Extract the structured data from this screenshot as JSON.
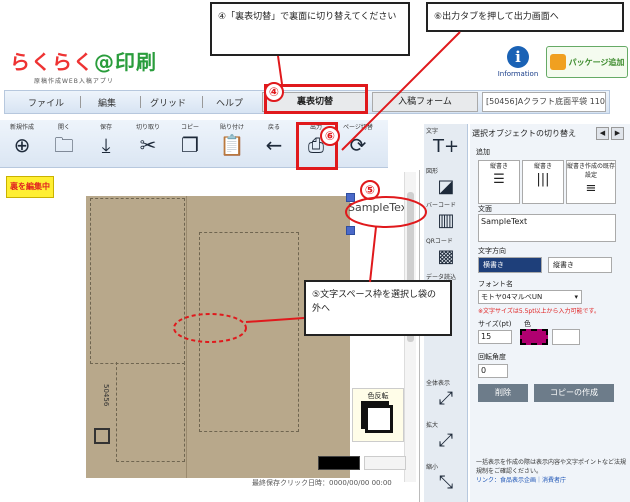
{
  "header": {
    "logo_text_red": "らくらく",
    "logo_text_green": "@印刷",
    "logo_ruby": "",
    "logo_sub": "原稿作成WEB入稿アプリ",
    "info_label": "Information",
    "package_label": "パッケージ追加"
  },
  "menu": {
    "file": "ファイル",
    "edit": "編集",
    "grid": "グリッド",
    "help": "ヘルプ",
    "flip": "裏表切替",
    "input_form": "入稿フォーム",
    "template": "[50456]Aクラフト底面平袋 110…"
  },
  "toolbar": {
    "items": [
      {
        "label": "新規作成",
        "glyph": "⊕"
      },
      {
        "label": "開く",
        "glyph": "🗀"
      },
      {
        "label": "保存",
        "glyph": "⤓"
      },
      {
        "label": "切り取り",
        "glyph": "✂"
      },
      {
        "label": "コピー",
        "glyph": "❐"
      },
      {
        "label": "貼り付け",
        "glyph": "📋"
      },
      {
        "label": "戻る",
        "glyph": "←"
      },
      {
        "label": "出力",
        "glyph": "⎙"
      },
      {
        "label": "ページ切替",
        "glyph": "⟳"
      }
    ]
  },
  "canvas": {
    "back_badge": "裏を編集中",
    "sample_text": "SampleText",
    "reverse_label": "色反転",
    "save_time": "最終保存クリック日時：0000/00/00 00:00",
    "barcode_text": "50456"
  },
  "side_tools": [
    {
      "label": "文字",
      "glyph": "T+"
    },
    {
      "label": "図形",
      "glyph": "◪"
    },
    {
      "label": "バーコード",
      "glyph": "▥"
    },
    {
      "label": "QRコード",
      "glyph": "▩"
    },
    {
      "label": "データ読込",
      "glyph": ""
    },
    {
      "label": "全体表示",
      "glyph": "⤢"
    },
    {
      "label": "拡大",
      "glyph": "⤢"
    },
    {
      "label": "縮小",
      "glyph": "⤡"
    }
  ],
  "panel": {
    "title": "選択オブジェクトの切り替え",
    "prev": "◀",
    "next": "▶",
    "add_label": "追加",
    "orient": [
      {
        "label": "縦書き",
        "glyph": "☰"
      },
      {
        "label": "縦書き",
        "glyph": "|||"
      },
      {
        "label": "縦書き作成の既存設定",
        "glyph": "≡"
      }
    ],
    "text_label": "文面",
    "text_value": "SampleText",
    "dir_label": "文字方向",
    "dir_h": "横書き",
    "dir_v": "縦書き",
    "font_label": "フォント名",
    "font_value": "モトヤ04マルベUN",
    "font_note": "※文字サイズは5.5pt以上から入力可能です。",
    "size_label": "サイズ(pt)",
    "color_label": "色",
    "size_value": "15",
    "rotation_label": "回転角度",
    "rotation_value": "0",
    "delete_btn": "削除",
    "copy_btn": "コピーの作成",
    "foot": "一括表示を作成の際は表示内容や文字ポイントなど法規規制をご確認ください。",
    "foot_link": "リンク：食品表示企画｜消費者庁"
  },
  "annotations": {
    "callout4": "④「裏表切替」で裏面に切り替えてください",
    "callout6": "⑥出力タブを押して出力画面へ",
    "callout5": "⑤文字スペース枠を選択し袋の外へ",
    "n4": "④",
    "n5": "⑤",
    "n6": "⑥",
    "accent": "#e0191c"
  }
}
